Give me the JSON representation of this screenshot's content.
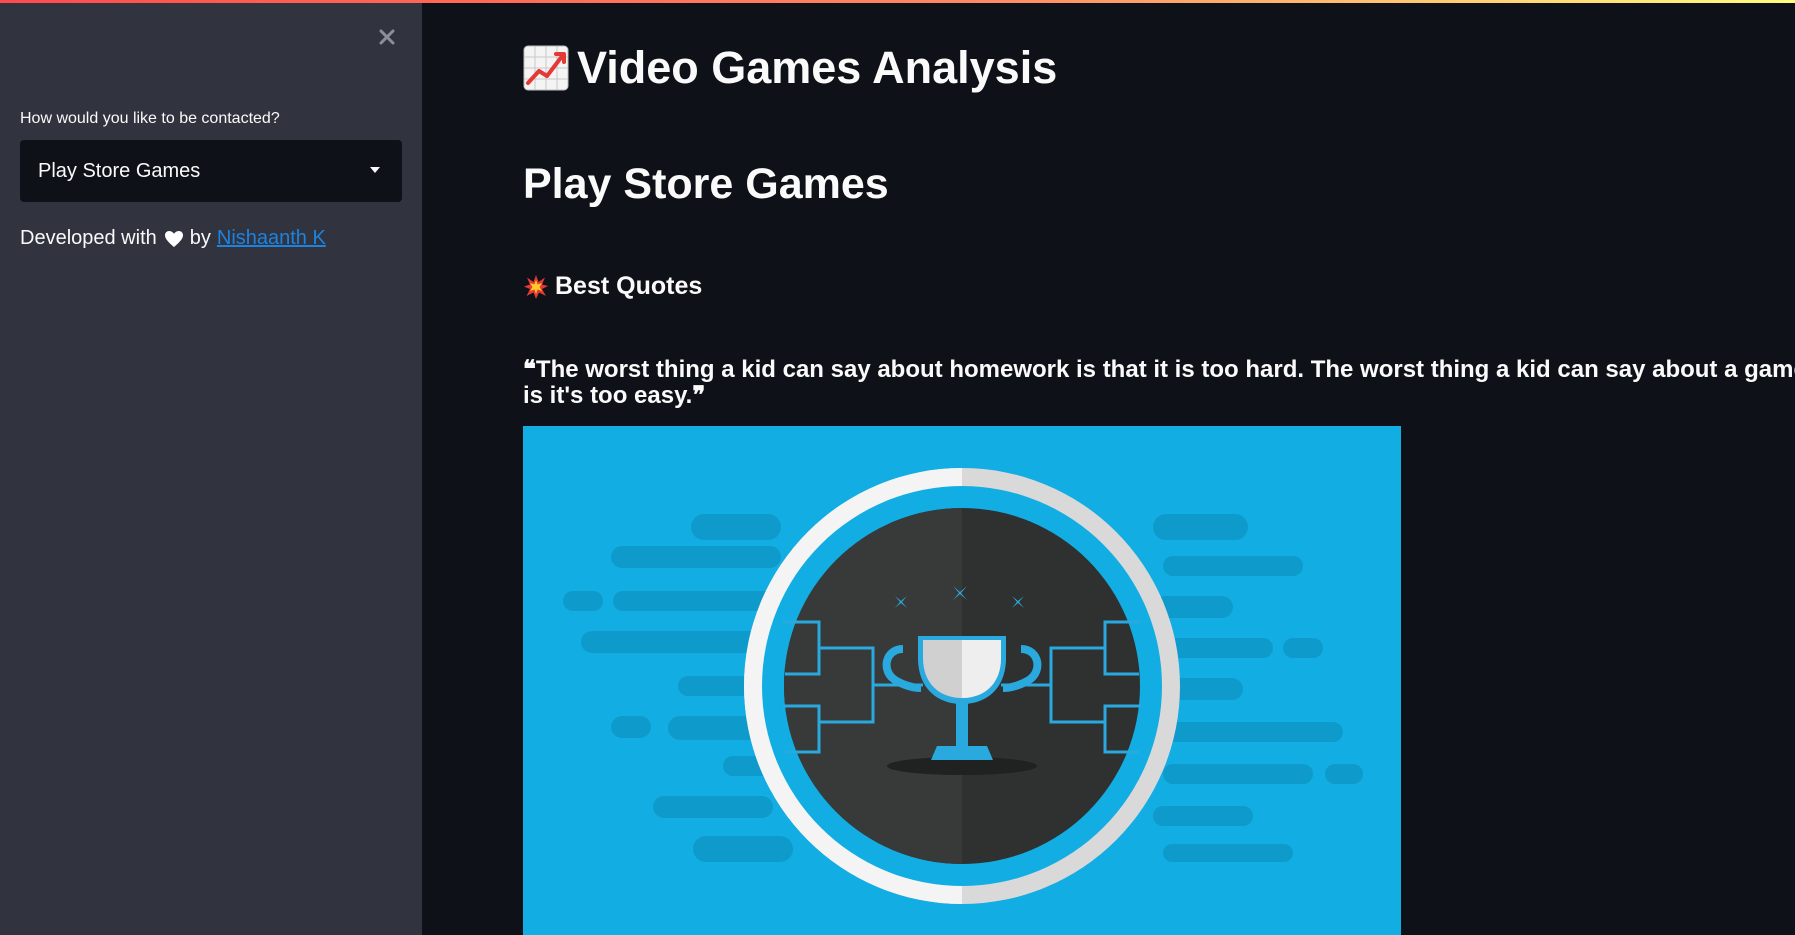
{
  "sidebar": {
    "select_label": "How would you like to be contacted?",
    "select_value": "Play Store Games",
    "dev_prefix": "Developed with",
    "dev_by": "by",
    "author_link": "Nishaanth K"
  },
  "main": {
    "app_title": "Video Games Analysis",
    "section_title": "Play Store Games",
    "subheader": "Best Quotes",
    "quote": "❝The worst thing a kid can say about homework is that it is too hard. The worst thing a kid can say about a game is it's too easy.❞"
  },
  "icons": {
    "close": "close-icon",
    "heart": "heart-icon",
    "chart": "chart-increasing-icon",
    "collision": "collision-icon",
    "caret": "chevron-down-icon"
  },
  "colors": {
    "accent_link": "#1c83e1",
    "sidebar_bg": "#31333f",
    "main_bg": "#0e1117",
    "image_bg": "#12ade2"
  }
}
